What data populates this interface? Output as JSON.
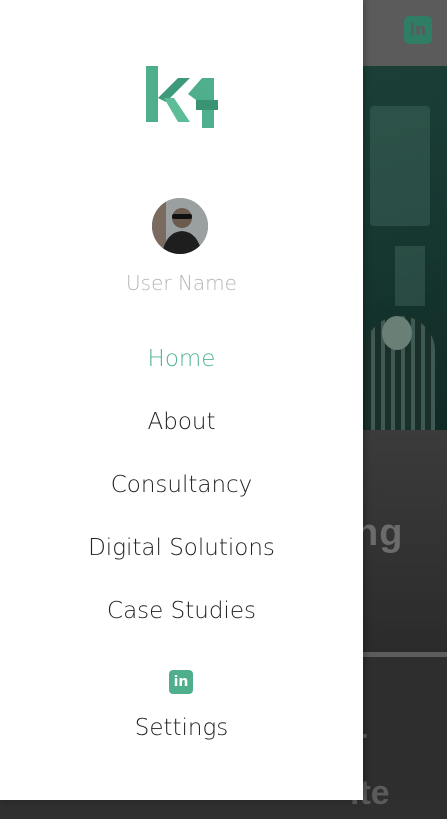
{
  "drawer": {
    "logo_text": "k4",
    "user_name": "User Name",
    "nav_items": [
      {
        "label": "Home",
        "active": true
      },
      {
        "label": "About",
        "active": false
      },
      {
        "label": "Consultancy",
        "active": false
      },
      {
        "label": "Digital Solutions",
        "active": false
      },
      {
        "label": "Case Studies",
        "active": false
      }
    ],
    "linkedin_icon": "linkedin-icon",
    "settings_label": "Settings"
  },
  "background": {
    "linkedin_icon": "linkedin-icon",
    "card_text": "ng",
    "card2_text_line1": "r",
    "card2_text_line2": "ite"
  },
  "colors": {
    "accent": "#52b592",
    "text": "#222222",
    "muted": "#b5b5b5"
  }
}
